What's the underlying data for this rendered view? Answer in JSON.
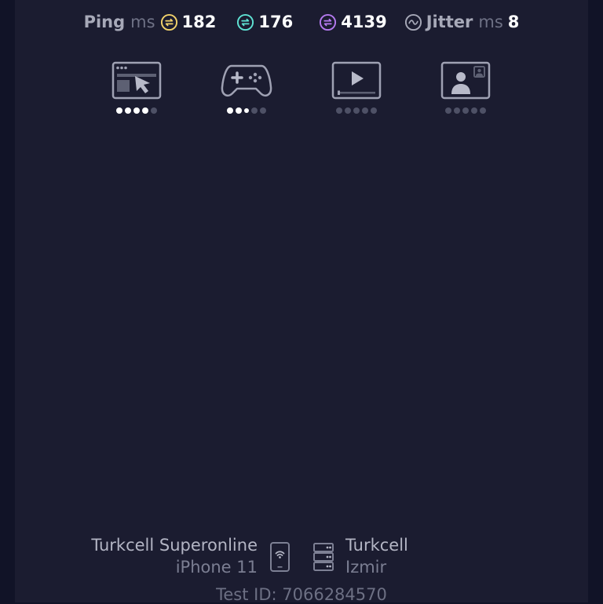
{
  "metrics": {
    "ping_label": "Ping",
    "ping_unit": "ms",
    "ping_idle": "182",
    "ping_download": "176",
    "ping_upload": "4139",
    "jitter_label": "Jitter",
    "jitter_unit": "ms",
    "jitter_value": "8",
    "colors": {
      "idle": "#f3d36b",
      "download": "#5fe3d4",
      "upload": "#b57af0",
      "jitter": "#a7a9b8"
    }
  },
  "connection_quality": [
    {
      "icon": "web-browsing-icon",
      "level": 4,
      "max": 5
    },
    {
      "icon": "gaming-icon",
      "level": 2,
      "partial": true,
      "max": 5
    },
    {
      "icon": "video-streaming-icon",
      "level": 0,
      "max": 5
    },
    {
      "icon": "video-call-icon",
      "level": 0,
      "max": 5
    }
  ],
  "footer": {
    "provider": "Turkcell Superonline",
    "device": "iPhone 11",
    "server_name": "Turkcell",
    "server_location": "Izmir",
    "test_id": "Test ID: 7066284570"
  }
}
